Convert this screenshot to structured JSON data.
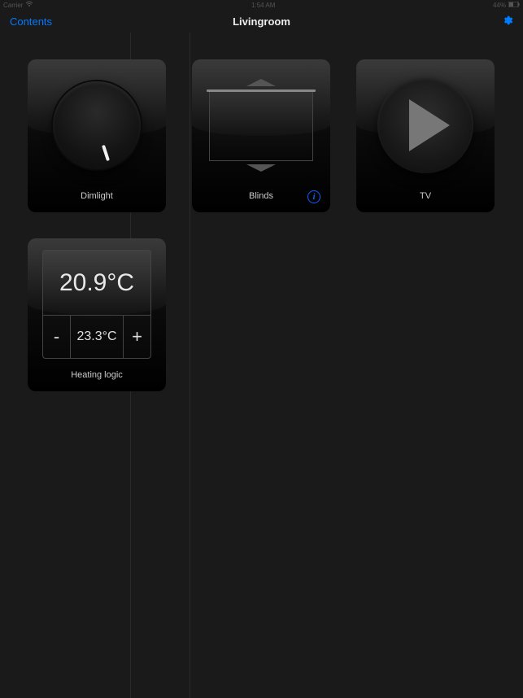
{
  "status": {
    "carrier": "Carrier",
    "time": "1:54 AM",
    "battery": "44%"
  },
  "nav": {
    "back": "Contents",
    "title": "Livingroom"
  },
  "tiles": {
    "dimlight": {
      "label": "Dimlight"
    },
    "blinds": {
      "label": "Blinds"
    },
    "tv": {
      "label": "TV"
    },
    "heating": {
      "label": "Heating logic",
      "current": "20.9°C",
      "target": "23.3°C",
      "minus": "-",
      "plus": "+"
    }
  }
}
